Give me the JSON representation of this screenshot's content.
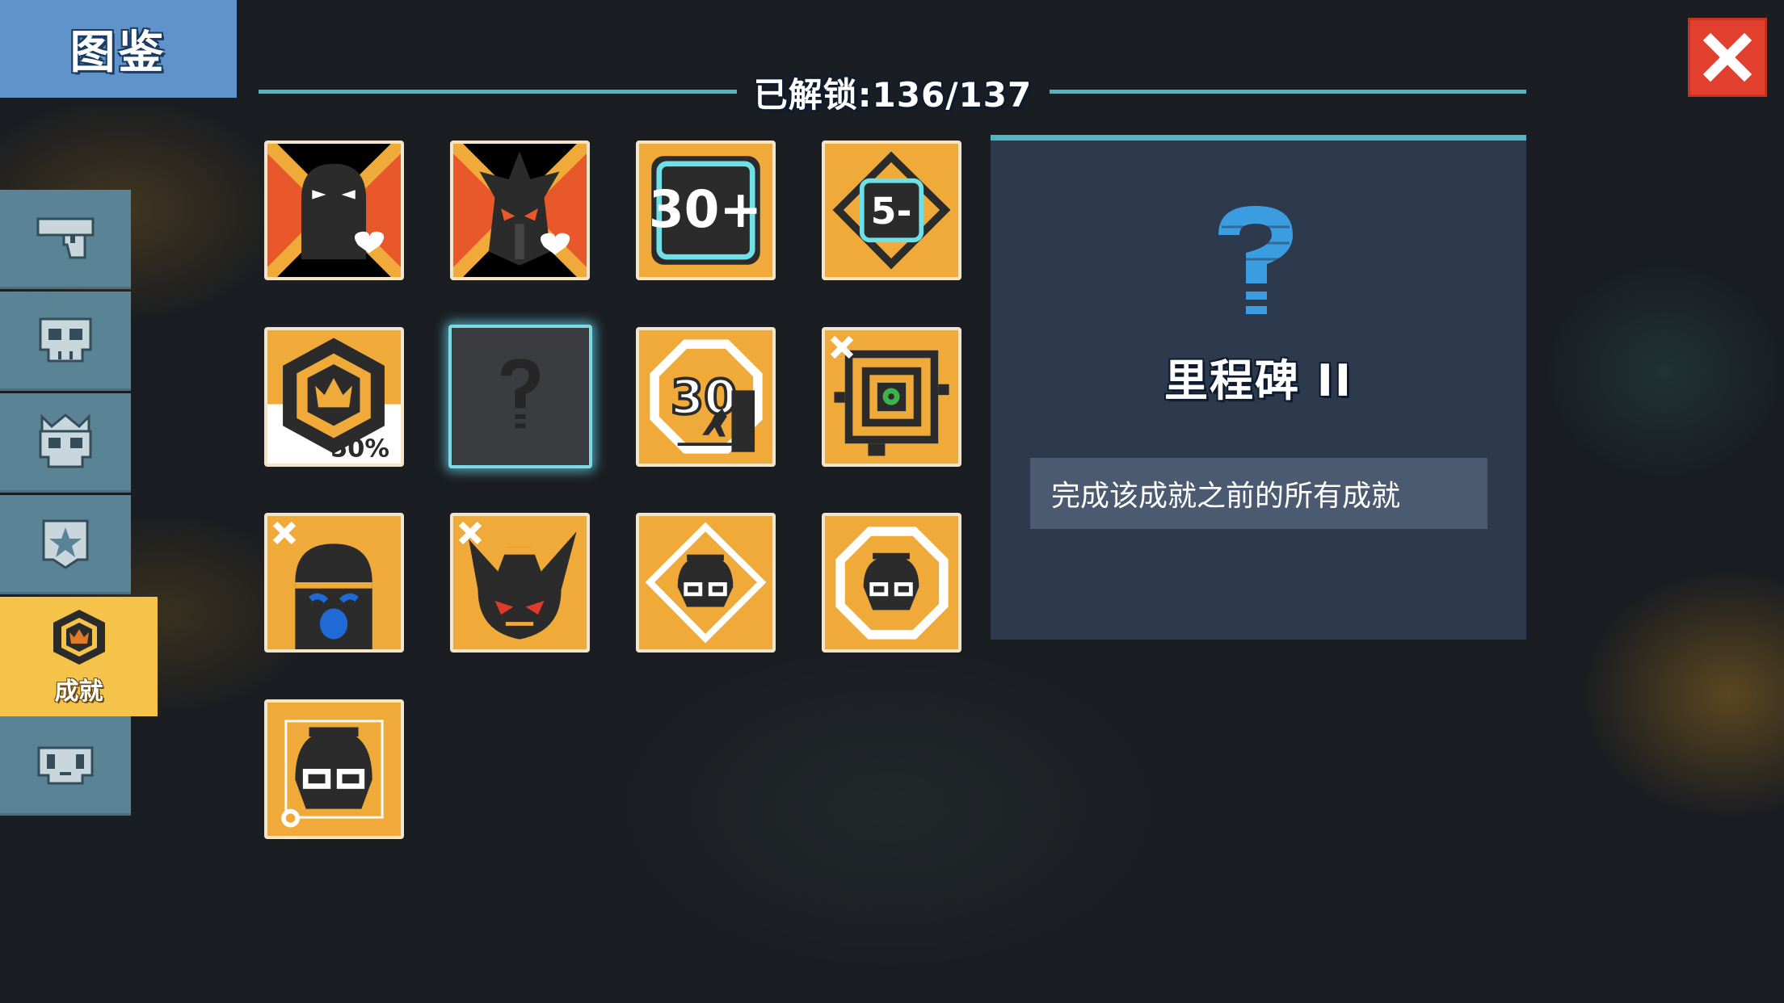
{
  "title": "图鉴",
  "header": {
    "unlocked_label": "已解锁:136/137"
  },
  "close_icon": "close-x-icon",
  "sidebar": {
    "tabs": [
      {
        "icon": "pistol-icon",
        "label": "",
        "active": false
      },
      {
        "icon": "skull-icon",
        "label": "",
        "active": false
      },
      {
        "icon": "crowned-skull-icon",
        "label": "",
        "active": false
      },
      {
        "icon": "star-badge-icon",
        "label": "",
        "active": false
      },
      {
        "icon": "crown-hexagon-icon",
        "label": "成就",
        "active": true
      },
      {
        "icon": "face-icon",
        "label": "",
        "active": false
      }
    ]
  },
  "achievements": [
    {
      "icon": "hooded-ninja-heart-icon",
      "unlocked": true
    },
    {
      "icon": "horned-demon-heart-icon",
      "unlocked": true
    },
    {
      "icon": "30-plus-icon",
      "text": "30+",
      "unlocked": true
    },
    {
      "icon": "5-minus-diamond-icon",
      "text": "5-",
      "unlocked": true
    },
    {
      "icon": "crown-hexagon-50-icon",
      "text": "50%",
      "unlocked": true
    },
    {
      "icon": "question-mark-icon",
      "text": "?",
      "unlocked": false,
      "selected": true
    },
    {
      "icon": "30-octagon-runner-icon",
      "text": "30",
      "unlocked": true
    },
    {
      "icon": "target-chip-icon",
      "unlocked": true
    },
    {
      "icon": "crying-helmet-icon",
      "unlocked": true
    },
    {
      "icon": "spiky-demon-icon",
      "unlocked": true
    },
    {
      "icon": "goggles-diamond-icon",
      "unlocked": true
    },
    {
      "icon": "goggles-octagon-icon",
      "unlocked": true
    },
    {
      "icon": "goggles-square-icon",
      "unlocked": true
    }
  ],
  "detail": {
    "icon": "question-mark-icon",
    "name": "里程碑 II",
    "description": "完成该成就之前的所有成就"
  },
  "colors": {
    "accent_cyan": "#4fb7c1",
    "tile_orange": "#f0aa3a",
    "tile_red": "#e8582b",
    "close_red": "#e2402e",
    "title_blue": "#5f93c9",
    "panel_bg": "#2d3a4e"
  }
}
